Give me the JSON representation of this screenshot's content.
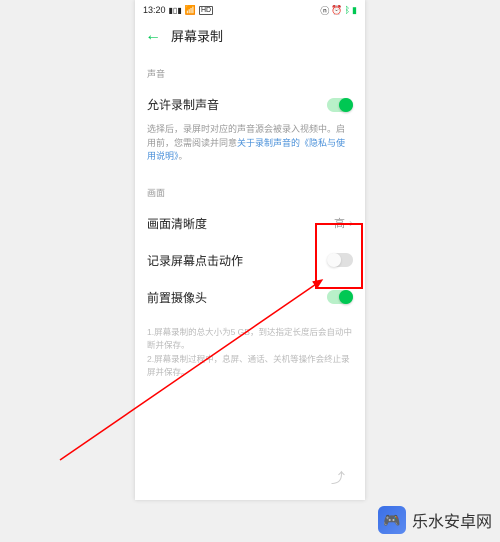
{
  "status": {
    "time": "13:20",
    "hd": "HD"
  },
  "header": {
    "title": "屏幕录制"
  },
  "sections": {
    "sound_label": "声音",
    "allow_sound_title": "允许录制声音",
    "allow_sound_desc_pre": "选择后，录屏时对应的声音源会被录入视频中。启用前，您需阅读并同意",
    "allow_sound_link": "关于录制声音的《隐私与使用说明》",
    "allow_sound_desc_post": "。",
    "picture_label": "画面",
    "clarity_title": "画面清晰度",
    "clarity_value": "高",
    "record_taps_title": "记录屏幕点击动作",
    "front_camera_title": "前置摄像头"
  },
  "notes": {
    "line1": "1.屏幕录制的总大小为5 GB，到达指定长度后会自动中断并保存。",
    "line2": "2.屏幕录制过程中，息屏、通话、关机等操作会终止录屏并保存。"
  },
  "watermark": {
    "text": "乐水安卓网",
    "icon": "🎮"
  }
}
